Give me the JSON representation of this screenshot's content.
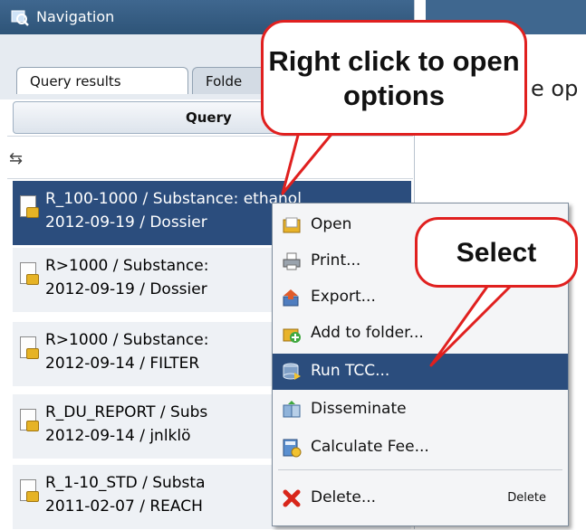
{
  "nav": {
    "title": "Navigation",
    "tabs": [
      {
        "label": "Query results",
        "active": true
      },
      {
        "label": "Folde",
        "active": false
      }
    ],
    "column_header": "Query",
    "filter_icon": "filter-swap-icon",
    "rows": [
      {
        "line1": "R_100-1000 / Substance: ethanol",
        "line2": "2012-09-19 / Dossier",
        "selected": true
      },
      {
        "line1": "R>1000 / Substance: ",
        "line2": "2012-09-19 / Dossier",
        "selected": false
      },
      {
        "line1": "R>1000 / Substance: ",
        "line2": "2012-09-14 / FILTER",
        "selected": false
      },
      {
        "line1": "R_DU_REPORT / Subs",
        "line2": "2012-09-14 / jnlklö",
        "selected": false
      },
      {
        "line1": "R_1-10_STD / Substa",
        "line2": "2011-02-07 / REACH",
        "selected": false
      }
    ]
  },
  "right_panel": {
    "partial_text": "e op"
  },
  "context_menu": {
    "items": [
      {
        "label": "Open",
        "icon": "folder-open-icon",
        "highlighted": false,
        "shortcut": ""
      },
      {
        "label": "Print...",
        "icon": "printer-icon",
        "highlighted": false,
        "shortcut": ""
      },
      {
        "label": "Export...",
        "icon": "export-icon",
        "highlighted": false,
        "shortcut": ""
      },
      {
        "label": "Add to folder...",
        "icon": "add-to-folder-icon",
        "highlighted": false,
        "shortcut": ""
      },
      {
        "label": "Run TCC...",
        "icon": "run-tcc-icon",
        "highlighted": true,
        "shortcut": ""
      },
      {
        "label": "Disseminate",
        "icon": "disseminate-icon",
        "highlighted": false,
        "shortcut": ""
      },
      {
        "label": "Calculate Fee...",
        "icon": "calculate-fee-icon",
        "highlighted": false,
        "shortcut": ""
      },
      {
        "label": "Delete...",
        "icon": "delete-x-icon",
        "highlighted": false,
        "shortcut": "Delete"
      }
    ]
  },
  "callouts": {
    "right_click": "Right click to open options",
    "select": "Select"
  },
  "colors": {
    "selection": "#2b4d7d",
    "title_bar": "#3f678f",
    "callout_border": "#e0201f"
  }
}
